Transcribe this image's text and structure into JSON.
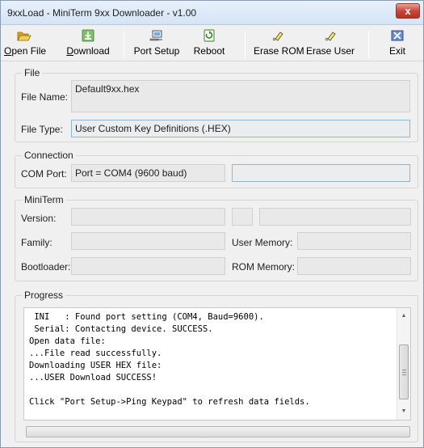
{
  "window": {
    "title": "9xxLoad  -  MiniTerm 9xx Downloader  -  v1.00",
    "close_label": "x"
  },
  "toolbar": {
    "items": [
      {
        "label_ul": "O",
        "label_rest": "pen File",
        "icon": "folder-open-icon"
      },
      {
        "label_ul": "D",
        "label_rest": "ownload",
        "icon": "download-icon"
      },
      {
        "label_ul": "",
        "label_rest": "Port Setup",
        "icon": "port-setup-icon"
      },
      {
        "label_ul": "",
        "label_rest": "Reboot",
        "icon": "reboot-icon"
      },
      {
        "label_ul": "",
        "label_rest": "Erase ROM",
        "icon": "eraser-icon"
      },
      {
        "label_ul": "",
        "label_rest": "Erase User",
        "icon": "eraser-icon"
      },
      {
        "label_ul": "",
        "label_rest": "Exit",
        "icon": "exit-icon"
      }
    ]
  },
  "file": {
    "legend": "File",
    "name_label": "File Name:",
    "name_value": "Default9xx.hex",
    "type_label": "File Type:",
    "type_value": "User Custom Key Definitions (.HEX)"
  },
  "connection": {
    "legend": "Connection",
    "port_label": "COM Port:",
    "port_value": "Port = COM4  (9600 baud)",
    "extra_value": ""
  },
  "miniterm": {
    "legend": "MiniTerm",
    "version_label": "Version:",
    "family_label": "Family:",
    "bootloader_label": "Bootloader:",
    "user_memory_label": "User Memory:",
    "rom_memory_label": "ROM Memory:",
    "version_value": "",
    "family_value": "",
    "bootloader_value": "",
    "user_memory_value": "",
    "rom_memory_value": ""
  },
  "progress": {
    "legend": "Progress",
    "log": " INI   : Found port setting (COM4, Baud=9600).\n Serial: Contacting device. SUCCESS.\nOpen data file:\n...File read successfully.\nDownloading USER HEX file:\n...USER Download SUCCESS!\n\nClick \"Port Setup->Ping Keypad\" to refresh data fields.",
    "percent": 0
  }
}
